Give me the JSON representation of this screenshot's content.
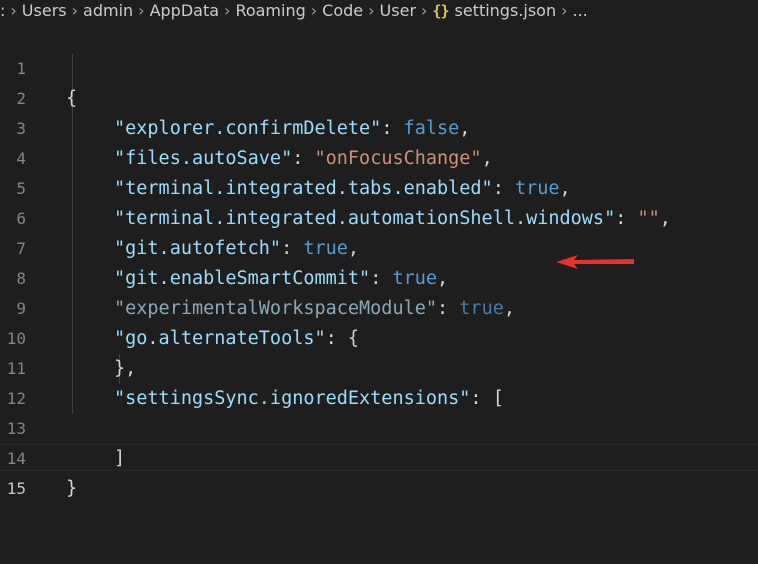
{
  "breadcrumb": {
    "items": [
      ":",
      "Users",
      "admin",
      "AppData",
      "Roaming",
      "Code",
      "User"
    ],
    "file_icon": "{}",
    "file_name": "settings.json",
    "tail": "..."
  },
  "editor": {
    "lines": [
      {
        "n": "1",
        "text": "{"
      },
      {
        "n": "2",
        "key": "\"explorer.confirmDelete\"",
        "value": "false",
        "value_type": "kw",
        "end": ","
      },
      {
        "n": "3",
        "key": "\"files.autoSave\"",
        "value": "\"onFocusChange\"",
        "value_type": "str",
        "end": ","
      },
      {
        "n": "4",
        "key": "\"terminal.integrated.tabs.enabled\"",
        "value": "true",
        "value_type": "kw",
        "end": ","
      },
      {
        "n": "5",
        "key": "\"terminal.integrated.automationShell.windows\"",
        "value": "\"\"",
        "value_type": "str",
        "end": ","
      },
      {
        "n": "6",
        "key": "\"git.autofetch\"",
        "value": "true",
        "value_type": "kw",
        "end": ","
      },
      {
        "n": "7",
        "key": "\"git.enableSmartCommit\"",
        "value": "true",
        "value_type": "kw",
        "end": ","
      },
      {
        "n": "8",
        "key": "\"experimentalWorkspaceModule\"",
        "value": "true",
        "value_type": "kw",
        "end": ","
      },
      {
        "n": "9",
        "key": "\"go.alternateTools\"",
        "value": "{",
        "value_type": "punc",
        "end": ""
      },
      {
        "n": "10",
        "text": "},"
      },
      {
        "n": "11",
        "key": "\"settingsSync.ignoredExtensions\"",
        "value": "[",
        "value_type": "punc",
        "end": ""
      },
      {
        "n": "12",
        "text": ""
      },
      {
        "n": "13",
        "text": "]"
      },
      {
        "n": "14",
        "text": "}"
      },
      {
        "n": "15",
        "text": ""
      }
    ]
  },
  "colors": {
    "background": "#1e1e1e",
    "key": "#9cdcfe",
    "string": "#ce9178",
    "keyword": "#569cd6",
    "annotation_arrow": "#e8312a"
  },
  "annotation": {
    "icon": "red-arrow-icon",
    "points_to_line": "8"
  }
}
